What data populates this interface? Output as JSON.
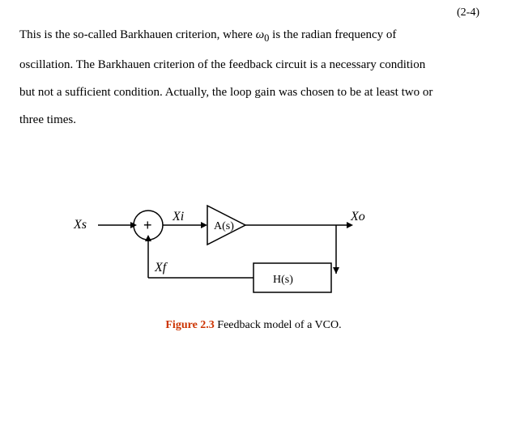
{
  "equation": {
    "label": "(2-4)"
  },
  "paragraph": {
    "text1": "This  is  the  so-called  Barkhauen  criterion,  where ",
    "omega_symbol": "ω",
    "omega_sub": "0",
    "text2": " is  the  radian  frequency  of",
    "text3": "oscillation.  The  Barkhauen  criterion  of  the  feedback  circuit  is  a  necessary  condition",
    "text4": "but not a sufficient condition. Actually, the loop gain was chosen to be at least two or",
    "text5": "three times."
  },
  "diagram": {
    "labels": {
      "Xs": "Xs",
      "Xi": "Xi",
      "Xo": "Xo",
      "Xf": "Xf",
      "As": "A(s)",
      "Hs": "H(s)"
    }
  },
  "figure": {
    "label": "Figure 2.3",
    "caption": " Feedback model of a VCO."
  }
}
